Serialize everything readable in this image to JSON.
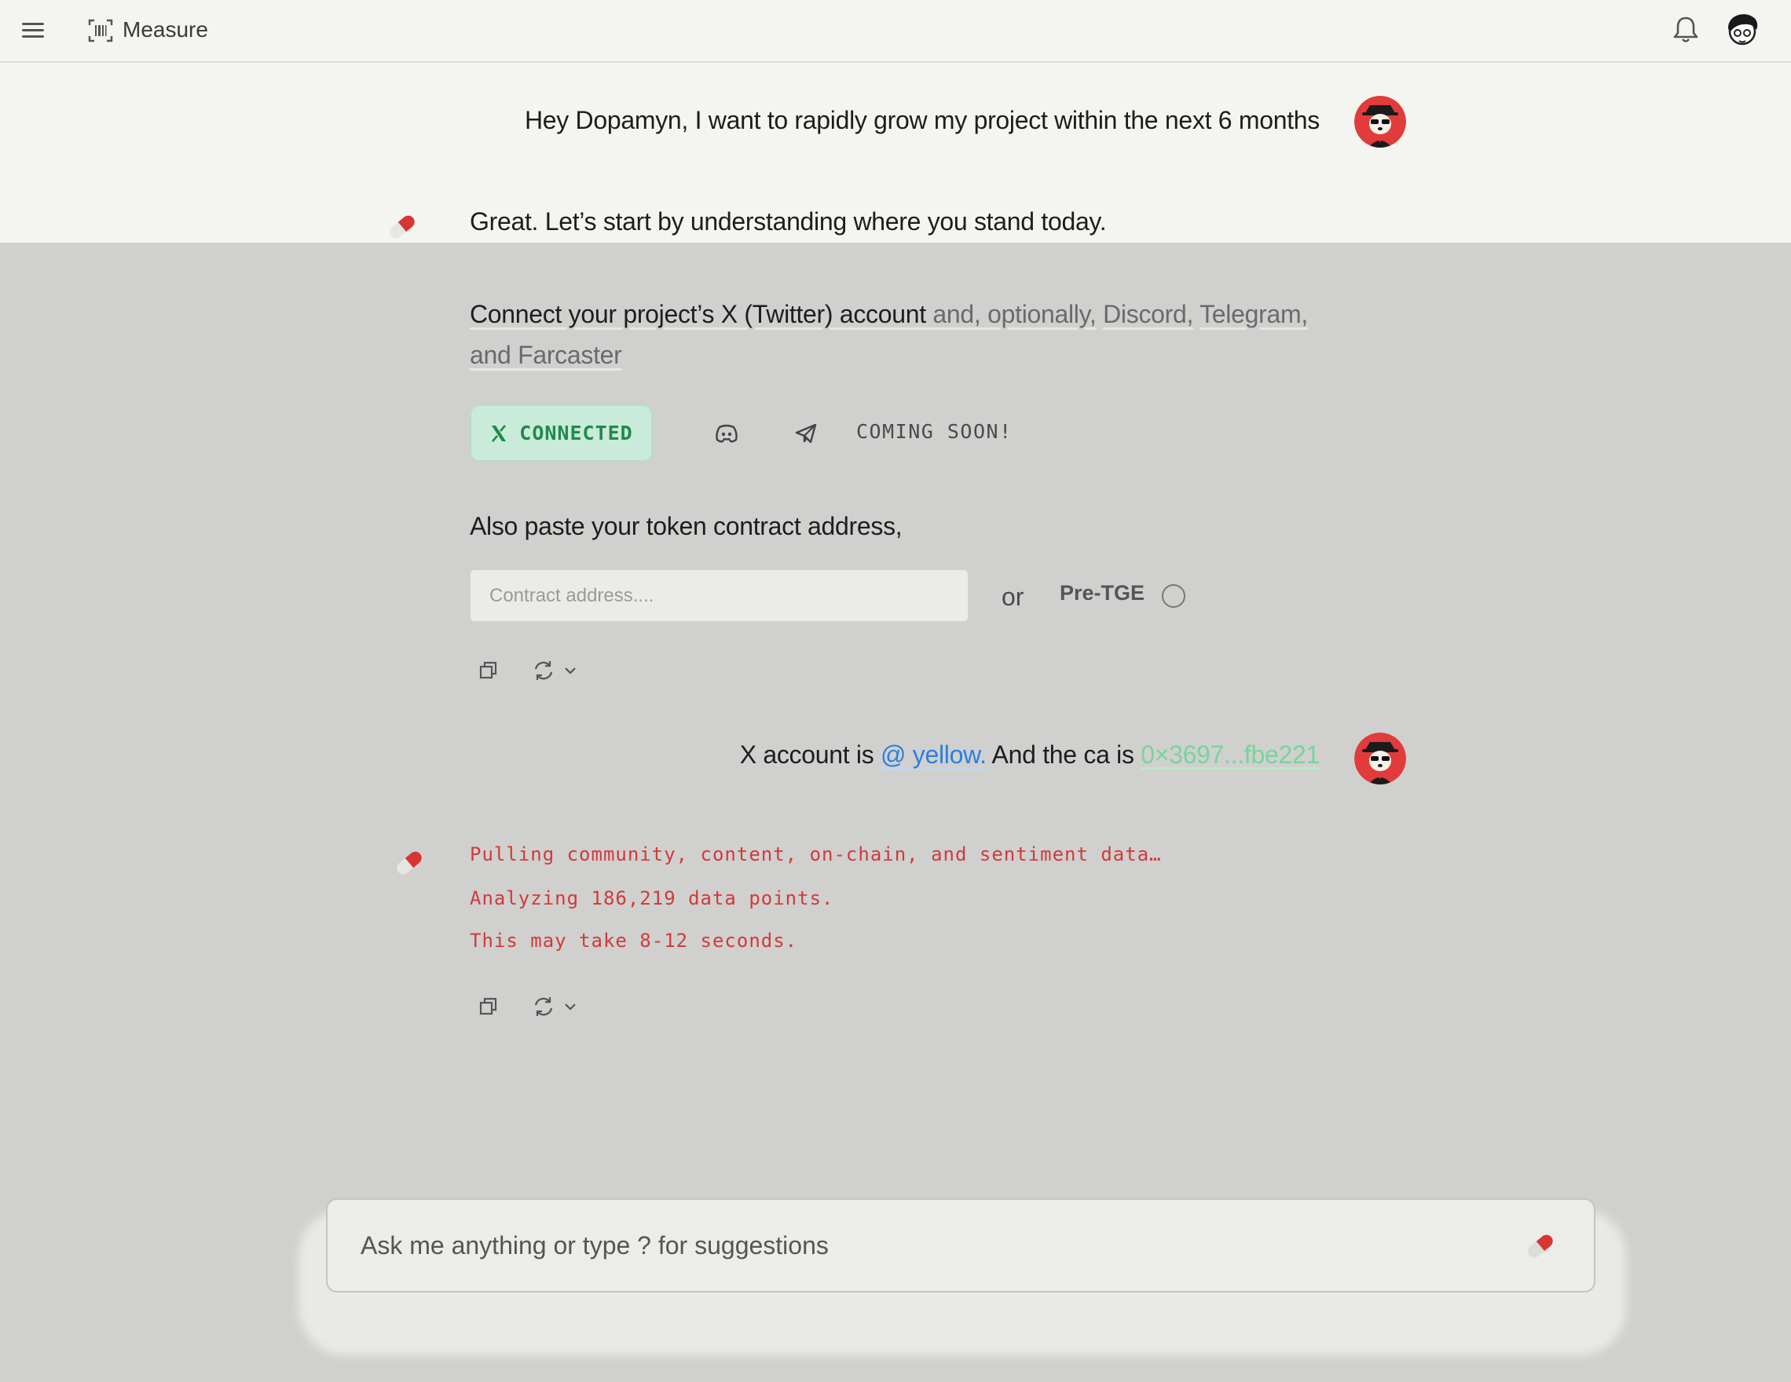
{
  "header": {
    "title": "Measure",
    "menu_icon": "hamburger-menu-icon",
    "app_icon": "barcode-scan-icon",
    "notification_icon": "bell-icon",
    "profile_icon": "user-avatar"
  },
  "conversation": {
    "user_message_1": "Hey Dopamyn, I want to rapidly grow my project within the next 6 months",
    "bot_message_1": "Great. Let’s start by understanding where you stand today.",
    "connect_prompt_main": "Connect your project’s X (Twitter) account",
    "connect_prompt_and": " and, optionally,",
    "connect_prompt_discord": "Discord,",
    "connect_prompt_telegram": "Telegram,",
    "connect_prompt_line2": "and Farcaster",
    "x_connected_label": "CONNECTED",
    "coming_soon_label": "COMING SOON!",
    "token_prompt": "Also paste your token contract address,",
    "contract_placeholder": "Contract address....",
    "contract_value": "",
    "or_label": "or",
    "pretge_label": "Pre-TGE",
    "pretge_selected": false,
    "user_message_2_prefix": "X account is ",
    "user_message_2_handle": "@ yellow.",
    "user_message_2_middle": " And the ca is ",
    "user_message_2_ca": "0×3697...fbe221",
    "terminal_lines": [
      "Pulling community, content, on-chain, and sentiment data…",
      "Analyzing 186,219 data points.",
      "This may take 8-12 seconds."
    ]
  },
  "composer": {
    "placeholder": "Ask me anything or type ? for suggestions",
    "send_icon": "pill-send-icon"
  },
  "colors": {
    "connected_bg": "#c9ebd9",
    "connected_text": "#1f8a4c",
    "terminal_text": "#d13a3a",
    "link_blue": "#2d7fe0",
    "link_green": "#78d49b",
    "page_bg": "#d0d0ce",
    "top_bg": "#f4f4f0"
  }
}
